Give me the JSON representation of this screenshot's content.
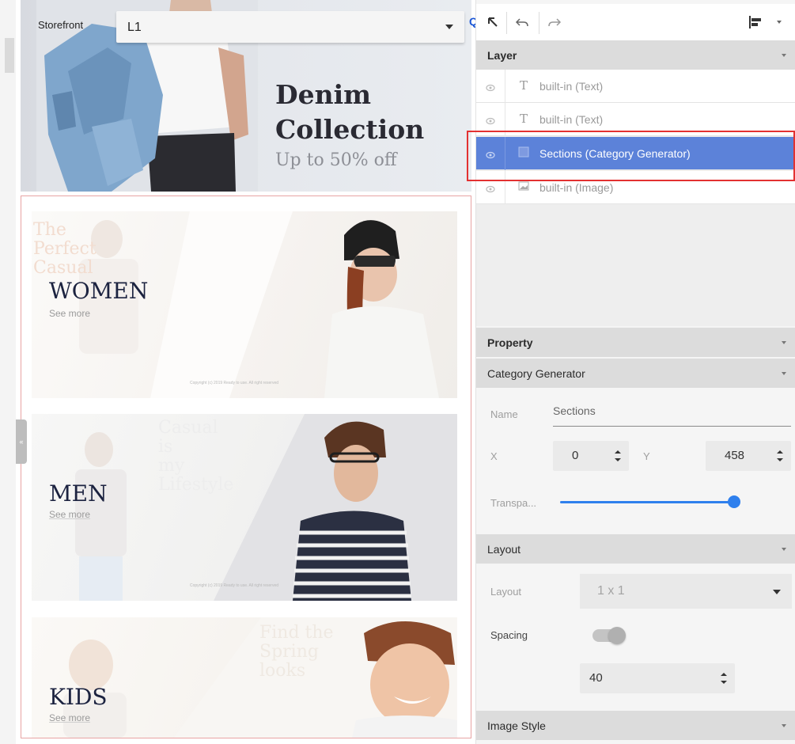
{
  "storefront": {
    "label": "Storefront",
    "selected": "L1",
    "q_label": "Q"
  },
  "hero": {
    "title_line1": "Denim",
    "title_line2": "Collection",
    "subtitle": "Up to 50% off"
  },
  "banners": [
    {
      "title": "WOMEN",
      "link": "See more",
      "script_lines": [
        "The",
        "Perfect",
        "Casual"
      ]
    },
    {
      "title": "MEN",
      "link": "See more",
      "script_lines": [
        "Casual",
        "is",
        "my",
        "Lifestyle"
      ]
    },
    {
      "title": "KIDS",
      "link": "See more",
      "script_lines": [
        "Find the",
        "Spring",
        "looks"
      ]
    }
  ],
  "copyright_text": "Copyright (c) 2019 Ready to use. All right reserved",
  "colors": {
    "accent": "#2f80ed",
    "selected_row": "#5c82d9",
    "highlight_outline": "#e33131",
    "section_border": "#e8a4a4"
  },
  "panel": {
    "layer": {
      "header": "Layer",
      "items": [
        {
          "label": "built-in (Text)",
          "icon": "text-icon",
          "selected": false
        },
        {
          "label": "built-in (Text)",
          "icon": "text-icon",
          "selected": false
        },
        {
          "label": "Sections (Category Generator)",
          "icon": "section-icon",
          "selected": true
        },
        {
          "label": "built-in (Image)",
          "icon": "image-icon",
          "selected": false
        }
      ]
    },
    "property": {
      "header": "Property",
      "subheader": "Category Generator",
      "name_label": "Name",
      "name_value": "Sections",
      "x_label": "X",
      "x_value": "0",
      "y_label": "Y",
      "y_value": "458",
      "transparency_label": "Transpa...",
      "transparency_value": 1.0
    },
    "layout": {
      "header": "Layout",
      "layout_label": "Layout",
      "layout_value": "1 x 1",
      "spacing_label": "Spacing",
      "spacing_enabled": true,
      "spacing_value": "40"
    },
    "image_style": {
      "header": "Image Style"
    }
  }
}
